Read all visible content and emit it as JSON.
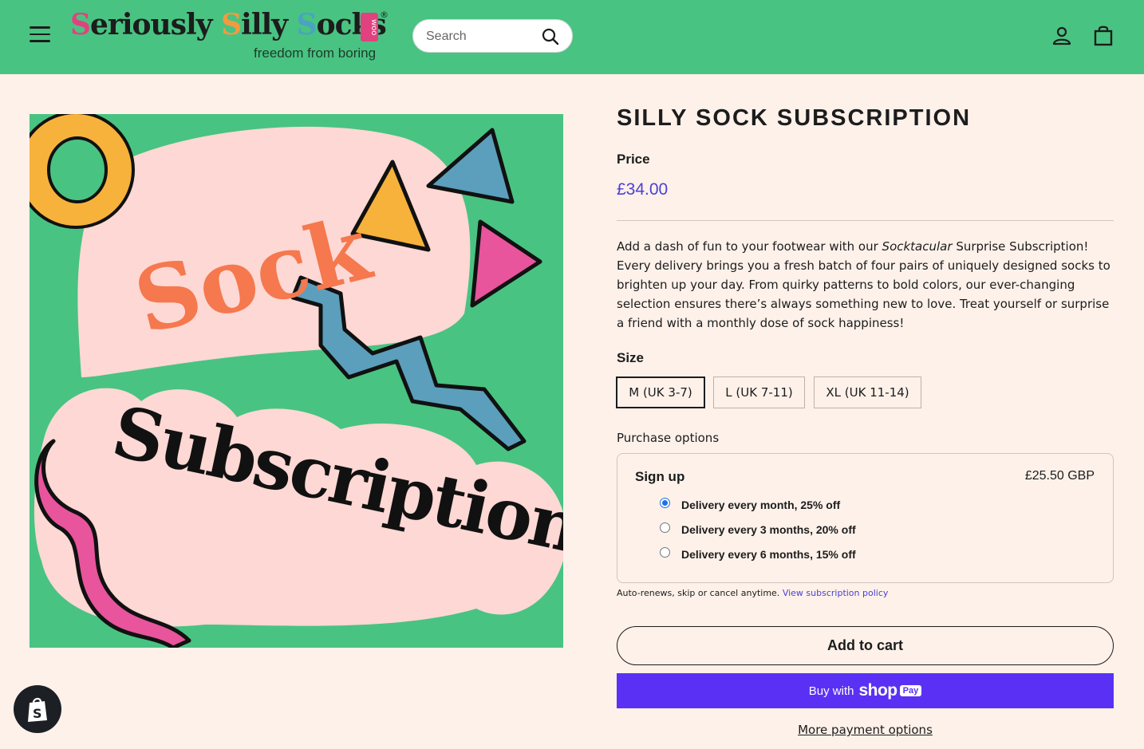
{
  "header": {
    "logo_text": {
      "part1": "S",
      "part2": "eriously",
      "part3": "S",
      "part4": "illy",
      "part5": "S",
      "part6": "ocks"
    },
    "logo_badge": "woo",
    "logo_reg": "®",
    "logo_tagline": "freedom from boring",
    "search_placeholder": "Search",
    "bg_color": "#49c382"
  },
  "product": {
    "image_text": {
      "line1": "Sock",
      "line2": "Subscription"
    },
    "title": "SILLY SOCK SUBSCRIPTION",
    "price_label": "Price",
    "price": "£34.00",
    "description_parts": {
      "before": "Add a dash of fun to your footwear with our ",
      "emphasis": "Socktacular",
      "after": " Surprise Subscription! Every delivery brings you a fresh batch of four pairs of uniquely designed socks to brighten up your day. From quirky patterns to bold colors, our ever-changing selection ensures there’s always something new to love. Treat yourself or surprise a friend with a monthly dose of sock happiness!"
    },
    "size_label": "Size",
    "sizes": [
      "M (UK 3-7)",
      "L (UK 7-11)",
      "XL (UK 11-14)"
    ],
    "selected_size": "M (UK 3-7)",
    "purchase_options_label": "Purchase options",
    "subscription": {
      "title": "Sign up",
      "price": "£25.50 GBP",
      "options": [
        "Delivery every month, 25% off",
        "Delivery every 3 months, 20% off",
        "Delivery every 6 months, 15% off"
      ],
      "selected_option": "Delivery every month, 25% off"
    },
    "policy_text": "Auto-renews, skip or cancel anytime.",
    "policy_link": "View subscription policy",
    "add_to_cart": "Add to cart",
    "buy_with": "Buy with",
    "shop_word": "shop",
    "pay_badge": "Pay",
    "more_payment": "More payment options"
  },
  "colors": {
    "accent": "#4a41d4",
    "shop_pay": "#5a31f4",
    "page_bg": "#fdf1ea"
  }
}
